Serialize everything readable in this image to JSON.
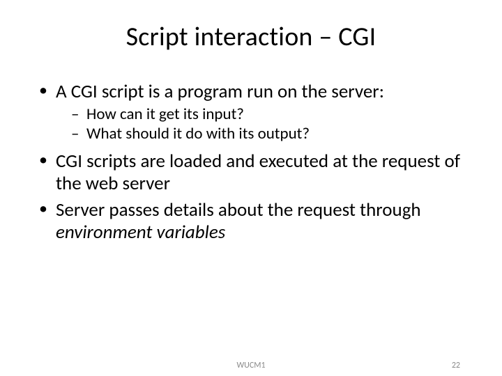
{
  "title": "Script interaction – CGI",
  "bullets": {
    "b1": "A CGI script is a program run on the server:",
    "b1_sub1": "How can it get its input?",
    "b1_sub2": "What should it do with its output?",
    "b2": "CGI scripts are loaded and executed at the request of the web server",
    "b3_pre": "Server passes details about the request through ",
    "b3_em": "environment variables"
  },
  "footer": {
    "center": "WUCM1",
    "page": "22"
  }
}
